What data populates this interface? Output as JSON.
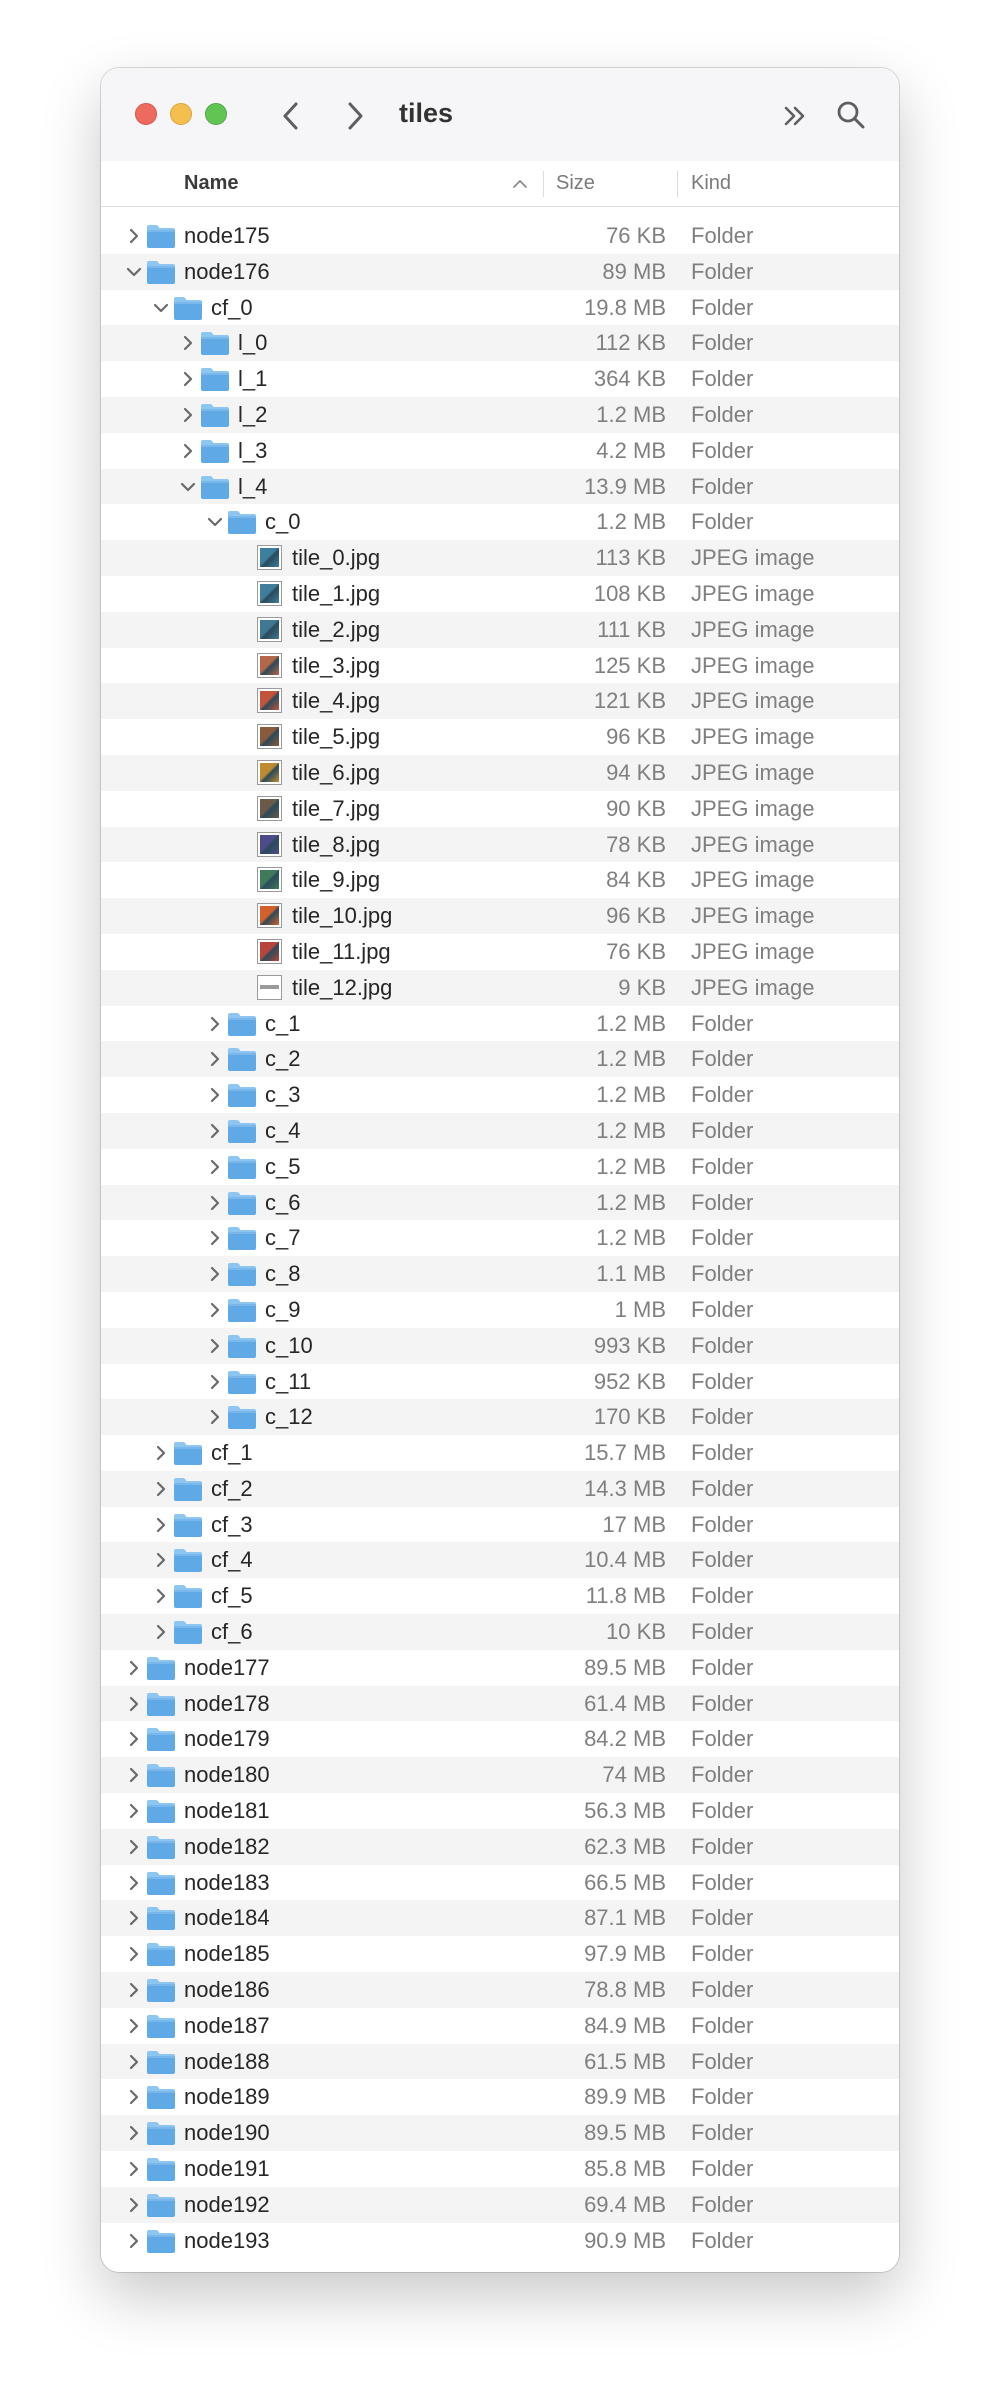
{
  "window": {
    "title": "tiles"
  },
  "toolbar": {
    "back_icon": "chevron-left-icon",
    "forward_icon": "chevron-right-icon",
    "more_icon": "double-chevron-icon",
    "search_icon": "search-icon"
  },
  "columns": {
    "name": "Name",
    "size": "Size",
    "kind": "Kind",
    "sort": "ascending"
  },
  "colors": {
    "folder": "#5fa9e6",
    "folder_tab": "#8ec6f2",
    "row_alt": "#f4f4f5",
    "close": "#ed6a5e",
    "minimize": "#f5bf4f",
    "zoom": "#61c554"
  },
  "rows": [
    {
      "name": "node175",
      "size": "76 KB",
      "kind": "Folder",
      "depth": 0,
      "type": "folder",
      "expanded": false
    },
    {
      "name": "node176",
      "size": "89 MB",
      "kind": "Folder",
      "depth": 0,
      "type": "folder",
      "expanded": true
    },
    {
      "name": "cf_0",
      "size": "19.8 MB",
      "kind": "Folder",
      "depth": 1,
      "type": "folder",
      "expanded": true
    },
    {
      "name": "l_0",
      "size": "112 KB",
      "kind": "Folder",
      "depth": 2,
      "type": "folder",
      "expanded": false
    },
    {
      "name": "l_1",
      "size": "364 KB",
      "kind": "Folder",
      "depth": 2,
      "type": "folder",
      "expanded": false
    },
    {
      "name": "l_2",
      "size": "1.2 MB",
      "kind": "Folder",
      "depth": 2,
      "type": "folder",
      "expanded": false
    },
    {
      "name": "l_3",
      "size": "4.2 MB",
      "kind": "Folder",
      "depth": 2,
      "type": "folder",
      "expanded": false
    },
    {
      "name": "l_4",
      "size": "13.9 MB",
      "kind": "Folder",
      "depth": 2,
      "type": "folder",
      "expanded": true
    },
    {
      "name": "c_0",
      "size": "1.2 MB",
      "kind": "Folder",
      "depth": 3,
      "type": "folder",
      "expanded": true
    },
    {
      "name": "tile_0.jpg",
      "size": "113 KB",
      "kind": "JPEG image",
      "depth": 4,
      "type": "image",
      "thumb": "#3d7fa0"
    },
    {
      "name": "tile_1.jpg",
      "size": "108 KB",
      "kind": "JPEG image",
      "depth": 4,
      "type": "image",
      "thumb": "#417e9c"
    },
    {
      "name": "tile_2.jpg",
      "size": "111 KB",
      "kind": "JPEG image",
      "depth": 4,
      "type": "image",
      "thumb": "#3f7893"
    },
    {
      "name": "tile_3.jpg",
      "size": "125 KB",
      "kind": "JPEG image",
      "depth": 4,
      "type": "image",
      "thumb": "#b5674a"
    },
    {
      "name": "tile_4.jpg",
      "size": "121 KB",
      "kind": "JPEG image",
      "depth": 4,
      "type": "image",
      "thumb": "#c3543a"
    },
    {
      "name": "tile_5.jpg",
      "size": "96 KB",
      "kind": "JPEG image",
      "depth": 4,
      "type": "image",
      "thumb": "#8a5a3c"
    },
    {
      "name": "tile_6.jpg",
      "size": "94 KB",
      "kind": "JPEG image",
      "depth": 4,
      "type": "image",
      "thumb": "#c08a2e"
    },
    {
      "name": "tile_7.jpg",
      "size": "90 KB",
      "kind": "JPEG image",
      "depth": 4,
      "type": "image",
      "thumb": "#6b5a4a"
    },
    {
      "name": "tile_8.jpg",
      "size": "78 KB",
      "kind": "JPEG image",
      "depth": 4,
      "type": "image",
      "thumb": "#4d4a8a"
    },
    {
      "name": "tile_9.jpg",
      "size": "84 KB",
      "kind": "JPEG image",
      "depth": 4,
      "type": "image",
      "thumb": "#3f7a5a"
    },
    {
      "name": "tile_10.jpg",
      "size": "96 KB",
      "kind": "JPEG image",
      "depth": 4,
      "type": "image",
      "thumb": "#d4602a"
    },
    {
      "name": "tile_11.jpg",
      "size": "76 KB",
      "kind": "JPEG image",
      "depth": 4,
      "type": "image",
      "thumb": "#b8453a"
    },
    {
      "name": "tile_12.jpg",
      "size": "9 KB",
      "kind": "JPEG image",
      "depth": 4,
      "type": "image",
      "thumb": "strip"
    },
    {
      "name": "c_1",
      "size": "1.2 MB",
      "kind": "Folder",
      "depth": 3,
      "type": "folder",
      "expanded": false
    },
    {
      "name": "c_2",
      "size": "1.2 MB",
      "kind": "Folder",
      "depth": 3,
      "type": "folder",
      "expanded": false
    },
    {
      "name": "c_3",
      "size": "1.2 MB",
      "kind": "Folder",
      "depth": 3,
      "type": "folder",
      "expanded": false
    },
    {
      "name": "c_4",
      "size": "1.2 MB",
      "kind": "Folder",
      "depth": 3,
      "type": "folder",
      "expanded": false
    },
    {
      "name": "c_5",
      "size": "1.2 MB",
      "kind": "Folder",
      "depth": 3,
      "type": "folder",
      "expanded": false
    },
    {
      "name": "c_6",
      "size": "1.2 MB",
      "kind": "Folder",
      "depth": 3,
      "type": "folder",
      "expanded": false
    },
    {
      "name": "c_7",
      "size": "1.2 MB",
      "kind": "Folder",
      "depth": 3,
      "type": "folder",
      "expanded": false
    },
    {
      "name": "c_8",
      "size": "1.1 MB",
      "kind": "Folder",
      "depth": 3,
      "type": "folder",
      "expanded": false
    },
    {
      "name": "c_9",
      "size": "1 MB",
      "kind": "Folder",
      "depth": 3,
      "type": "folder",
      "expanded": false
    },
    {
      "name": "c_10",
      "size": "993 KB",
      "kind": "Folder",
      "depth": 3,
      "type": "folder",
      "expanded": false
    },
    {
      "name": "c_11",
      "size": "952 KB",
      "kind": "Folder",
      "depth": 3,
      "type": "folder",
      "expanded": false
    },
    {
      "name": "c_12",
      "size": "170 KB",
      "kind": "Folder",
      "depth": 3,
      "type": "folder",
      "expanded": false
    },
    {
      "name": "cf_1",
      "size": "15.7 MB",
      "kind": "Folder",
      "depth": 1,
      "type": "folder",
      "expanded": false
    },
    {
      "name": "cf_2",
      "size": "14.3 MB",
      "kind": "Folder",
      "depth": 1,
      "type": "folder",
      "expanded": false
    },
    {
      "name": "cf_3",
      "size": "17 MB",
      "kind": "Folder",
      "depth": 1,
      "type": "folder",
      "expanded": false
    },
    {
      "name": "cf_4",
      "size": "10.4 MB",
      "kind": "Folder",
      "depth": 1,
      "type": "folder",
      "expanded": false
    },
    {
      "name": "cf_5",
      "size": "11.8 MB",
      "kind": "Folder",
      "depth": 1,
      "type": "folder",
      "expanded": false
    },
    {
      "name": "cf_6",
      "size": "10 KB",
      "kind": "Folder",
      "depth": 1,
      "type": "folder",
      "expanded": false
    },
    {
      "name": "node177",
      "size": "89.5 MB",
      "kind": "Folder",
      "depth": 0,
      "type": "folder",
      "expanded": false
    },
    {
      "name": "node178",
      "size": "61.4 MB",
      "kind": "Folder",
      "depth": 0,
      "type": "folder",
      "expanded": false
    },
    {
      "name": "node179",
      "size": "84.2 MB",
      "kind": "Folder",
      "depth": 0,
      "type": "folder",
      "expanded": false
    },
    {
      "name": "node180",
      "size": "74 MB",
      "kind": "Folder",
      "depth": 0,
      "type": "folder",
      "expanded": false
    },
    {
      "name": "node181",
      "size": "56.3 MB",
      "kind": "Folder",
      "depth": 0,
      "type": "folder",
      "expanded": false
    },
    {
      "name": "node182",
      "size": "62.3 MB",
      "kind": "Folder",
      "depth": 0,
      "type": "folder",
      "expanded": false
    },
    {
      "name": "node183",
      "size": "66.5 MB",
      "kind": "Folder",
      "depth": 0,
      "type": "folder",
      "expanded": false
    },
    {
      "name": "node184",
      "size": "87.1 MB",
      "kind": "Folder",
      "depth": 0,
      "type": "folder",
      "expanded": false
    },
    {
      "name": "node185",
      "size": "97.9 MB",
      "kind": "Folder",
      "depth": 0,
      "type": "folder",
      "expanded": false
    },
    {
      "name": "node186",
      "size": "78.8 MB",
      "kind": "Folder",
      "depth": 0,
      "type": "folder",
      "expanded": false
    },
    {
      "name": "node187",
      "size": "84.9 MB",
      "kind": "Folder",
      "depth": 0,
      "type": "folder",
      "expanded": false
    },
    {
      "name": "node188",
      "size": "61.5 MB",
      "kind": "Folder",
      "depth": 0,
      "type": "folder",
      "expanded": false
    },
    {
      "name": "node189",
      "size": "89.9 MB",
      "kind": "Folder",
      "depth": 0,
      "type": "folder",
      "expanded": false
    },
    {
      "name": "node190",
      "size": "89.5 MB",
      "kind": "Folder",
      "depth": 0,
      "type": "folder",
      "expanded": false
    },
    {
      "name": "node191",
      "size": "85.8 MB",
      "kind": "Folder",
      "depth": 0,
      "type": "folder",
      "expanded": false
    },
    {
      "name": "node192",
      "size": "69.4 MB",
      "kind": "Folder",
      "depth": 0,
      "type": "folder",
      "expanded": false
    },
    {
      "name": "node193",
      "size": "90.9 MB",
      "kind": "Folder",
      "depth": 0,
      "type": "folder",
      "expanded": false
    }
  ]
}
